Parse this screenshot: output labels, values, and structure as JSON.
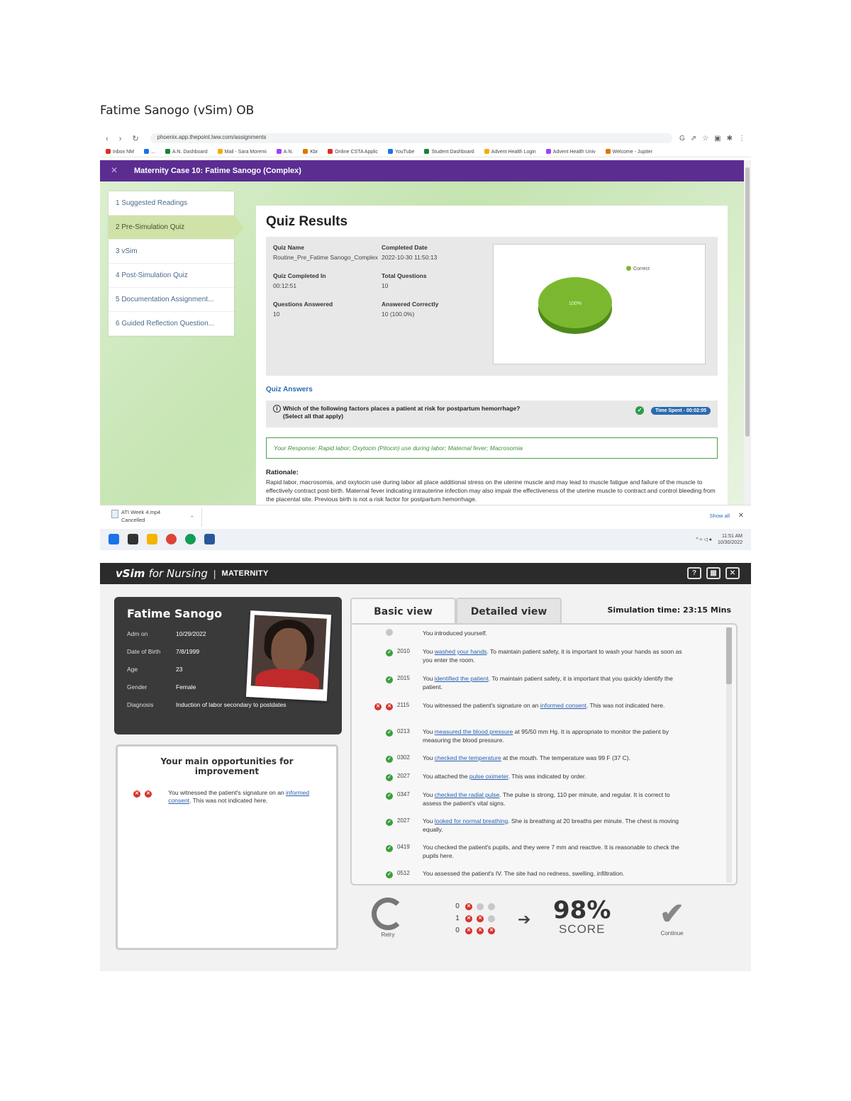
{
  "doc": {
    "title": "Fatime Sanogo (vSim) OB"
  },
  "browser": {
    "url": "phoenix.app.thepoint.lww.com/assignments",
    "bookmarks": [
      "Inbox NM",
      "...",
      "A.N. Dashboard",
      "Mail - Sara Moremi",
      "A.N.",
      "Kbr",
      "Online CSTA Applic",
      "YouTube",
      "Student Dashboard",
      "Advent Health Login",
      "Advent Health Univ",
      "Welcome - Jupiter"
    ],
    "accent": "#5b2d91"
  },
  "app": {
    "close_icon": "×",
    "title": "Maternity Case 10: Fatime Sanogo (Complex)",
    "steps": [
      "1 Suggested Readings",
      "2 Pre-Simulation Quiz",
      "3 vSim",
      "4 Post-Simulation Quiz",
      "5 Documentation Assignment...",
      "6 Guided Reflection Question..."
    ],
    "active_step": 1
  },
  "quiz": {
    "title": "Quiz Results",
    "summary": {
      "quiz_name_label": "Quiz Name",
      "quiz_name": "Routine_Pre_Fatime Sanogo_Complex",
      "completed_date_label": "Completed Date",
      "completed_date": "2022-10-30 11:50:13",
      "completed_in_label": "Quiz Completed In",
      "completed_in": "00:12:51",
      "total_questions_label": "Total Questions",
      "total_questions": "10",
      "answered_label": "Questions Answered",
      "answered": "10",
      "correct_label": "Answered Correctly",
      "correct": "10 (100.0%)"
    },
    "pie": {
      "legend": "Correct",
      "label": "100%",
      "value": 100,
      "color": "#7cb82f"
    },
    "answers_title": "Quiz Answers",
    "question": {
      "text": "Which of the following factors places a patient at risk for postpartum hemorrhage?",
      "sub": "(Select all that apply)",
      "time_spent": "Time Spent - 00:02:05"
    },
    "response": "Your Response: Rapid labor; Oxytocin (Pitocin) use during labor; Maternal fever; Macrosomia",
    "rationale_label": "Rationale:",
    "rationale": "Rapid labor, macrosomia, and oxytocin use during labor all place additional stress on the uterine muscle and may lead to muscle fatigue and failure of the muscle to effectively contract post-birth. Maternal fever indicating intrauterine infection may also impair the effectiveness of the uterine muscle to contract and control bleeding from the placental site. Previous birth is not a risk factor for postpartum hemorrhage."
  },
  "downloads": {
    "file": "ATI Week 4.mp4",
    "status": "Cancelled",
    "show_all": "Show all"
  },
  "taskbar": {
    "time": "11:51 AM",
    "date": "10/30/2022"
  },
  "vsim": {
    "brand": "vSim",
    "brand_for": "for Nursing",
    "module": "MATERNITY",
    "patient": {
      "name": "Fatime Sanogo",
      "fields": [
        {
          "label": "Adm on",
          "value": "10/29/2022"
        },
        {
          "label": "Date of Birth",
          "value": "7/8/1999"
        },
        {
          "label": "Age",
          "value": "23"
        },
        {
          "label": "Gender",
          "value": "Female"
        },
        {
          "label": "Diagnosis",
          "value": "Induction of labor secondary to postdates"
        }
      ]
    },
    "improvement": {
      "title": "Your main opportunities for improvement",
      "text_before": "You witnessed the patient's signature on an",
      "link": "informed consent",
      "text_after": ". This was not indicated here."
    },
    "tabs": [
      "Basic view",
      "Detailed view"
    ],
    "sim_time": "Simulation time: 23:15 Mins",
    "log": [
      {
        "status": "neutral",
        "code": "",
        "pre": "You introduced yourself.",
        "link": "",
        "post": ""
      },
      {
        "status": "ok",
        "code": "2010",
        "pre": "You ",
        "link": "washed your hands",
        "post": ". To maintain patient safety, it is important to wash your hands as soon as you enter the room."
      },
      {
        "status": "ok",
        "code": "2015",
        "pre": "You ",
        "link": "identified the patient",
        "post": ". To maintain patient safety, it is important that you quickly identify the patient."
      },
      {
        "status": "bad",
        "code": "2115",
        "pre": "You witnessed the patient's signature on an ",
        "link": "informed consent",
        "post": ". This was not indicated here."
      },
      {
        "status": "ok",
        "code": "0213",
        "pre": "You ",
        "link": "measured the blood pressure",
        "post": " at 95/50 mm Hg. It is appropriate to monitor the patient by measuring the blood pressure."
      },
      {
        "status": "ok",
        "code": "0302",
        "pre": "You ",
        "link": "checked the temperature",
        "post": " at the mouth. The temperature was 99 F (37 C)."
      },
      {
        "status": "ok",
        "code": "2027",
        "pre": "You attached the ",
        "link": "pulse oximeter",
        "post": ". This was indicated by order."
      },
      {
        "status": "ok",
        "code": "0347",
        "pre": "You ",
        "link": "checked the radial pulse",
        "post": ". The pulse is strong, 110 per minute, and regular. It is correct to assess the patient's vital signs."
      },
      {
        "status": "ok",
        "code": "2027",
        "pre": "You ",
        "link": "looked for normal breathing",
        "post": ". She is breathing at 20 breaths per minute. The chest is moving equally."
      },
      {
        "status": "ok",
        "code": "0419",
        "pre": "You checked the patient's pupils, and they were 7 mm and reactive. It is reasonable to check the pupils here.",
        "link": "",
        "post": ""
      },
      {
        "status": "ok",
        "code": "0512",
        "pre": "You assessed the patient's IV. The site had no redness, swelling, infiltration.",
        "link": "",
        "post": ""
      }
    ],
    "retry_label": "Retry",
    "tally": [
      {
        "count": "0",
        "marks": [
          "x",
          "grey",
          "grey"
        ]
      },
      {
        "count": "1",
        "marks": [
          "x",
          "x",
          "grey"
        ]
      },
      {
        "count": "0",
        "marks": [
          "x",
          "x",
          "x"
        ]
      }
    ],
    "score": "98%",
    "score_label": "SCORE",
    "continue_label": "Continue"
  }
}
